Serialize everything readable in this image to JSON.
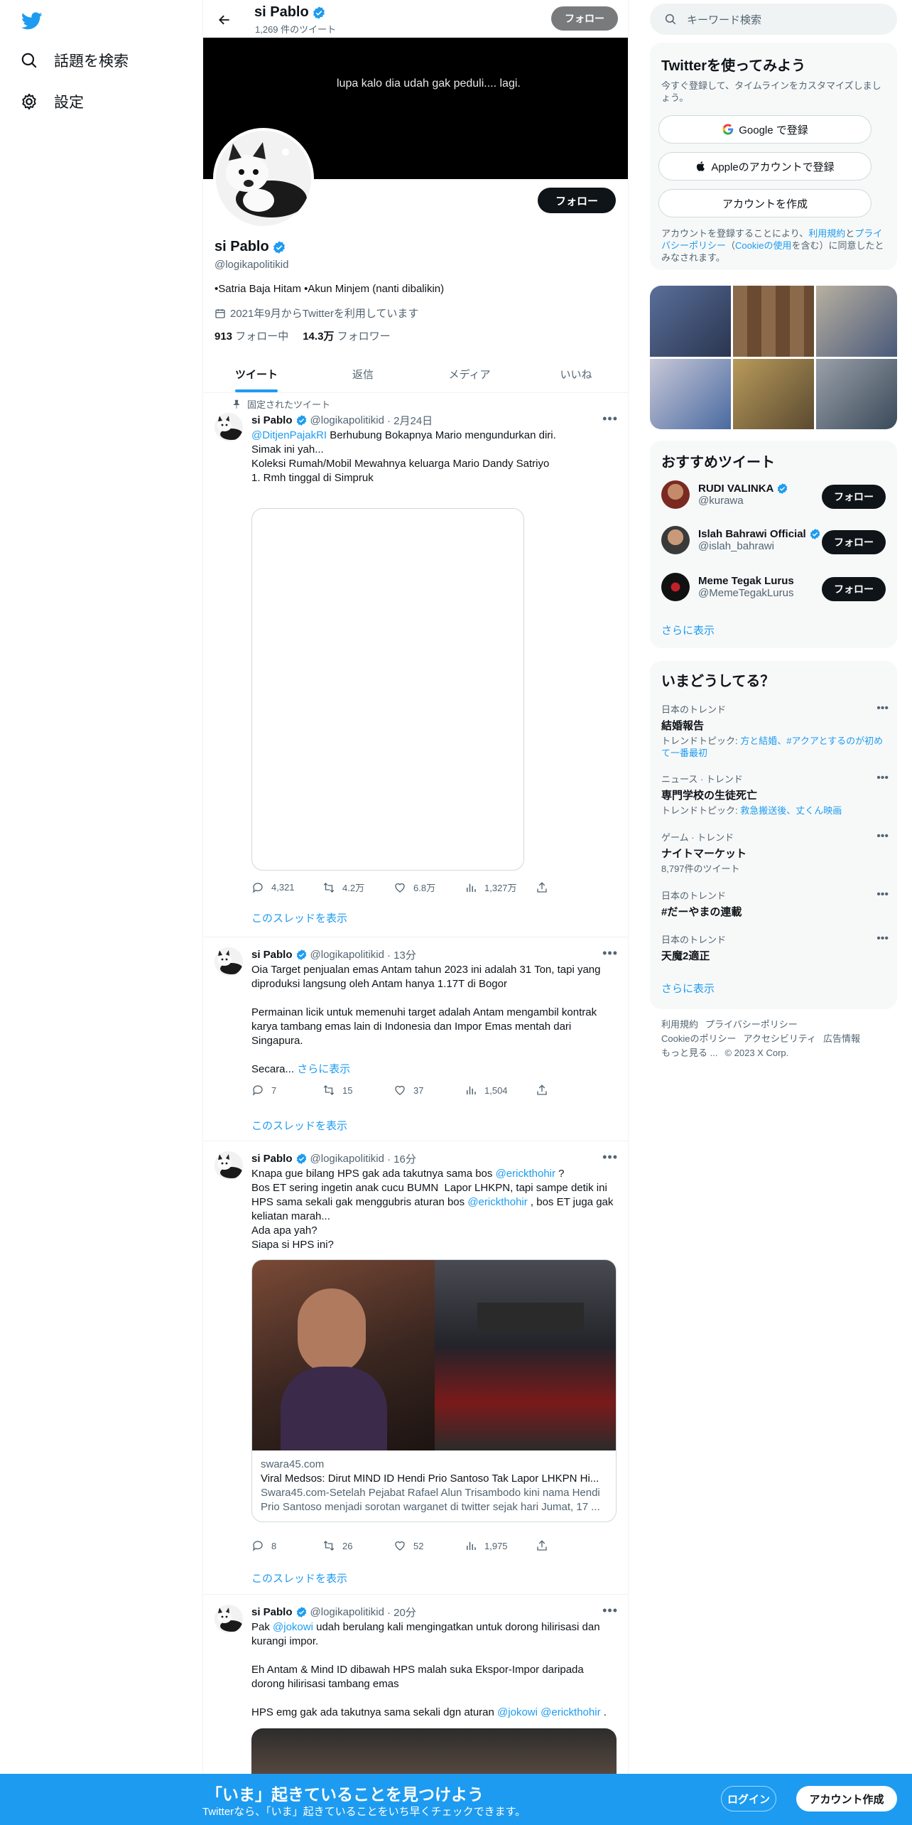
{
  "nav": {
    "explore_label": "話題を検索",
    "settings_label": "設定"
  },
  "header": {
    "name": "si Pablo",
    "tweet_count": "1,269 件のツイート",
    "follow_label": "フォロー"
  },
  "banner": {
    "text": "lupa kalo dia udah gak peduli.... lagi."
  },
  "profile": {
    "name": "si Pablo",
    "handle": "@logikapolitikid",
    "bio": "•Satria Baja Hitam •Akun Minjem (nanti dibalikin)",
    "joined": "2021年9月からTwitterを利用しています",
    "following_count": "913",
    "following_label": "フォロー中",
    "followers_count": "14.3万",
    "followers_label": "フォロワー",
    "follow_label": "フォロー"
  },
  "tabs": [
    "ツイート",
    "返信",
    "メディア",
    "いいね"
  ],
  "tweets": [
    {
      "pinned_label": "固定されたツイート",
      "name": "si Pablo",
      "handle": "@logikapolitikid",
      "time": "· 2月24日",
      "mention": "@DitjenPajakRI",
      "text_after_mention": " Berhubung Bokapnya Mario mengundurkan diri.",
      "text": "Simak ini yah...\nKoleksi Rumah/Mobil Mewahnya keluarga Mario Dandy Satriyo\n1. Rmh tinggal di Simpruk",
      "replies": "4,321",
      "retweets": "4.2万",
      "likes": "6.8万",
      "views": "1,327万",
      "thread_label": "このスレッドを表示"
    },
    {
      "name": "si Pablo",
      "handle": "@logikapolitikid",
      "time": "· 13分",
      "text": "Oia Target penjualan emas Antam tahun 2023 ini adalah 31 Ton, tapi yang diproduksi langsung oleh Antam hanya 1.17T di Bogor\n\nPermainan licik untuk memenuhi target adalah Antam mengambil kontrak karya tambang emas lain di Indonesia dan Impor Emas mentah dari Singapura.\n\nSecara...",
      "show_more": "さらに表示",
      "replies": "7",
      "retweets": "15",
      "likes": "37",
      "views": "1,504",
      "thread_label": "このスレッドを表示"
    },
    {
      "name": "si Pablo",
      "handle": "@logikapolitikid",
      "time": "· 16分",
      "line1_a": "Knapa gue bilang HPS gak ada takutnya sama bos ",
      "mention1": "@erickthohir",
      "line1_b": " ?",
      "line2": "Bos ET sering ingetin anak cucu BUMN  Lapor LHKPN, tapi sampe detik ini HPS sama sekali gak menggubris aturan bos ",
      "mention2": "@erickthohir",
      "line2_b": " , bos ET juga gak keliatan marah...",
      "line3": "Ada apa yah?\nSiapa si HPS ini?",
      "card_domain": "swara45.com",
      "card_title": "Viral Medsos: Dirut MIND ID Hendi Prio Santoso Tak Lapor LHKPN Hi...",
      "card_desc": "Swara45.com-Setelah Pejabat Rafael Alun Trisambodo kini nama Hendi Prio Santoso menjadi sorotan warganet di twitter sejak hari Jumat, 17 ...",
      "replies": "8",
      "retweets": "26",
      "likes": "52",
      "views": "1,975",
      "thread_label": "このスレッドを表示"
    },
    {
      "name": "si Pablo",
      "handle": "@logikapolitikid",
      "time": "· 20分",
      "pre": "Pak ",
      "mention1": "@jokowi",
      "line1": " udah berulang kali mengingatkan untuk dorong hilirisasi dan kurangi impor.",
      "para2": "Eh Antam & Mind ID dibawah HPS malah suka Ekspor-Impor daripada dorong hilirisasi tambang emas",
      "para3_a": "HPS emg gak ada takutnya sama sekali dgn aturan ",
      "mention2": "@jokowi",
      "mention3": "@erickthohir",
      "para3_b": " ."
    }
  ],
  "sidebar": {
    "search_placeholder": "キーワード検索",
    "signup": {
      "title": "Twitterを使ってみよう",
      "subtitle": "今すぐ登録して、タイムラインをカスタマイズしましょう。",
      "google_label": "Google で登録",
      "apple_label": "Appleのアカウントで登録",
      "create_label": "アカウントを作成",
      "legal_a": "アカウントを登録することにより、",
      "legal_link1": "利用規約",
      "legal_b": "と",
      "legal_link2": "プライバシーポリシー",
      "legal_c": "（",
      "legal_link3": "Cookieの使用",
      "legal_d": "を含む）に同意したとみなされます。"
    },
    "who_to_follow": {
      "title": "おすすめツイート",
      "accounts": [
        {
          "name": "RUDI VALINKA",
          "handle": "@kurawa",
          "verified": true
        },
        {
          "name": "Islah Bahrawi Official",
          "handle": "@islah_bahrawi",
          "verified": true
        },
        {
          "name": "Meme Tegak Lurus",
          "handle": "@MemeTegakLurus",
          "verified": false
        }
      ],
      "follow_label": "フォロー",
      "show_more": "さらに表示"
    },
    "trends": {
      "title": "いまどうしてる？",
      "items": [
        {
          "category": "日本のトレンド",
          "title": "結婚報告",
          "sub_prefix": "トレンドトピック: ",
          "sub_link": "方と結婚、#アクアとするのが初めて一番最初"
        },
        {
          "category": "ニュース · トレンド",
          "title": "専門学校の生徒死亡",
          "sub_prefix": "トレンドトピック: ",
          "sub_link": "救急搬送後、丈くん映画"
        },
        {
          "category": "ゲーム · トレンド",
          "title": "ナイトマーケット",
          "count": "8,797件のツイート"
        },
        {
          "category": "日本のトレンド",
          "title": "#だーやまの連載"
        },
        {
          "category": "日本のトレンド",
          "title": "天魔2適正"
        }
      ],
      "show_more": "さらに表示"
    },
    "footer": [
      "利用規約",
      "プライバシーポリシー",
      "Cookieのポリシー",
      "アクセシビリティ",
      "広告情報",
      "もっと見る ...",
      "© 2023 X Corp."
    ]
  },
  "bottom_bar": {
    "title": "「いま」起きていることを見つけよう",
    "subtitle": "Twitterなら、「いま」起きていることをいち早くチェックできます。",
    "login_label": "ログイン",
    "signup_label": "アカウント作成"
  },
  "colors": {
    "accent": "#1d9bf0",
    "text": "#0f1419",
    "muted": "#536471",
    "border": "#eff3f4"
  }
}
